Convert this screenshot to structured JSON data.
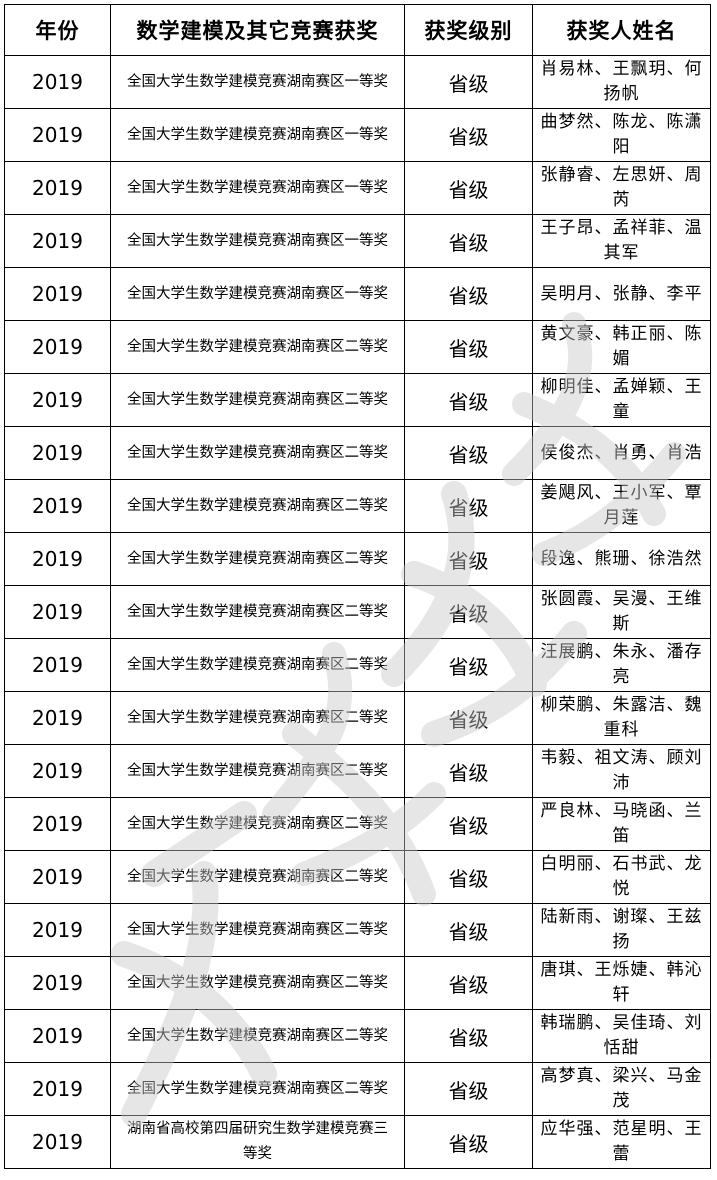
{
  "header": {
    "year": "年份",
    "award": "数学建模及其它竞赛获奖",
    "level": "获奖级别",
    "names": "获奖人姓名"
  },
  "rows": [
    {
      "year": "2019",
      "award": "全国大学生数学建模竞赛湖南赛区一等奖",
      "level": "省级",
      "names": "肖易林、王飘玥、何扬帆"
    },
    {
      "year": "2019",
      "award": "全国大学生数学建模竞赛湖南赛区一等奖",
      "level": "省级",
      "names": "曲梦然、陈龙、陈潇阳"
    },
    {
      "year": "2019",
      "award": "全国大学生数学建模竞赛湖南赛区一等奖",
      "level": "省级",
      "names": "张静睿、左思妍、周芮"
    },
    {
      "year": "2019",
      "award": "全国大学生数学建模竞赛湖南赛区一等奖",
      "level": "省级",
      "names": "王子昂、孟祥菲、温其军"
    },
    {
      "year": "2019",
      "award": "全国大学生数学建模竞赛湖南赛区一等奖",
      "level": "省级",
      "names": "吴明月、张静、李平"
    },
    {
      "year": "2019",
      "award": "全国大学生数学建模竞赛湖南赛区二等奖",
      "level": "省级",
      "names": "黄文豪、韩正丽、陈媚"
    },
    {
      "year": "2019",
      "award": "全国大学生数学建模竞赛湖南赛区二等奖",
      "level": "省级",
      "names": "柳明佳、孟婵颖、王童"
    },
    {
      "year": "2019",
      "award": "全国大学生数学建模竞赛湖南赛区二等奖",
      "level": "省级",
      "names": "侯俊杰、肖勇、肖浩"
    },
    {
      "year": "2019",
      "award": "全国大学生数学建模竞赛湖南赛区二等奖",
      "level": "省级",
      "names": "姜飓风、王小军、覃月莲"
    },
    {
      "year": "2019",
      "award": "全国大学生数学建模竞赛湖南赛区二等奖",
      "level": "省级",
      "names": "段逸、熊珊、徐浩然"
    },
    {
      "year": "2019",
      "award": "全国大学生数学建模竞赛湖南赛区二等奖",
      "level": "省级",
      "names": "张圆霞、吴漫、王维斯"
    },
    {
      "year": "2019",
      "award": "全国大学生数学建模竞赛湖南赛区二等奖",
      "level": "省级",
      "names": "汪展鹏、朱永、潘存亮"
    },
    {
      "year": "2019",
      "award": "全国大学生数学建模竞赛湖南赛区二等奖",
      "level": "省级",
      "names": "柳荣鹏、朱露洁、魏重科"
    },
    {
      "year": "2019",
      "award": "全国大学生数学建模竞赛湖南赛区二等奖",
      "level": "省级",
      "names": "韦毅、祖文涛、顾刘沛"
    },
    {
      "year": "2019",
      "award": "全国大学生数学建模竞赛湖南赛区二等奖",
      "level": "省级",
      "names": "严良林、马晓函、兰笛"
    },
    {
      "year": "2019",
      "award": "全国大学生数学建模竞赛湖南赛区二等奖",
      "level": "省级",
      "names": "白明丽、石书武、龙悦"
    },
    {
      "year": "2019",
      "award": "全国大学生数学建模竞赛湖南赛区二等奖",
      "level": "省级",
      "names": "陆新雨、谢璨、王兹扬"
    },
    {
      "year": "2019",
      "award": "全国大学生数学建模竞赛湖南赛区二等奖",
      "level": "省级",
      "names": "唐琪、王烁婕、韩沁轩"
    },
    {
      "year": "2019",
      "award": "全国大学生数学建模竞赛湖南赛区二等奖",
      "level": "省级",
      "names": "韩瑞鹏、吴佳琦、刘恬甜"
    },
    {
      "year": "2019",
      "award": "全国大学生数学建模竞赛湖南赛区二等奖",
      "level": "省级",
      "names": "高梦真、梁兴、马金茂"
    },
    {
      "year": "2019",
      "award": "湖南省高校第四届研究生数学建模竞赛三等奖",
      "level": "省级",
      "names": "应华强、范星明、王蕾"
    }
  ],
  "watermark": {
    "color": "#c8c8c8"
  }
}
